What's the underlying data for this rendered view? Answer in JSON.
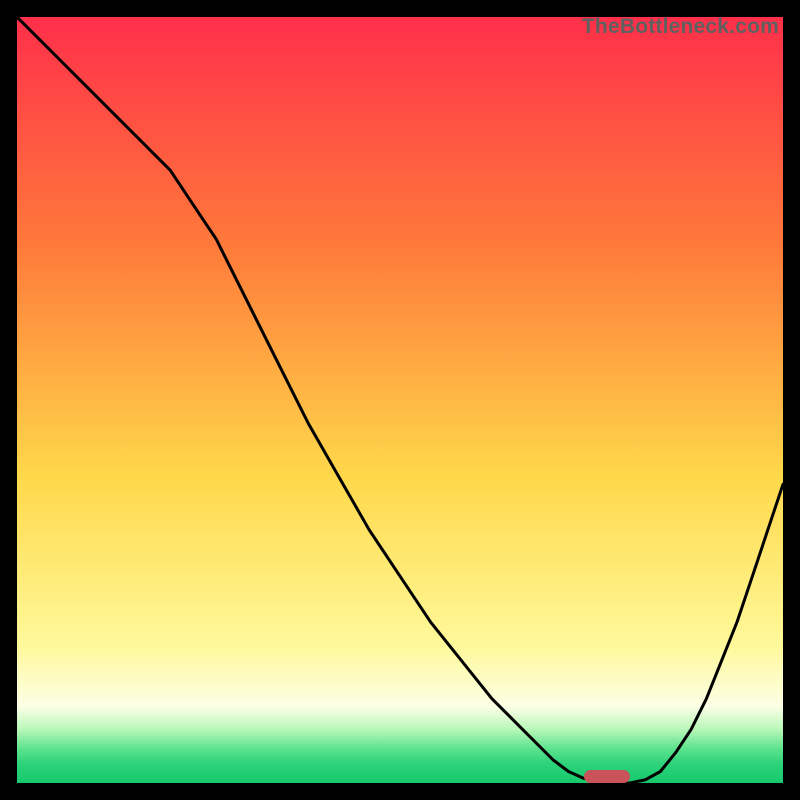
{
  "watermark_text": "TheBottleneck.com",
  "colors": {
    "background": "#000000",
    "gradient_top": "#ff2f4a",
    "gradient_mid_upper": "#ff7a3a",
    "gradient_mid": "#ffd84a",
    "gradient_mid_lower": "#fff99a",
    "gradient_pale": "#fcffe6",
    "gradient_green1": "#b8f7b8",
    "gradient_green2": "#5de38e",
    "gradient_green3": "#2dd37a",
    "gradient_bottom": "#15c96b",
    "curve": "#000000",
    "marker": "#c95359"
  },
  "chart_data": {
    "type": "line",
    "title": "",
    "xlabel": "",
    "ylabel": "",
    "xlim": [
      0,
      100
    ],
    "ylim": [
      0,
      100
    ],
    "x": [
      0,
      2,
      4,
      6,
      8,
      10,
      12,
      14,
      16,
      18,
      20,
      22,
      24,
      26,
      28,
      30,
      32,
      34,
      38,
      42,
      46,
      50,
      54,
      58,
      62,
      66,
      70,
      72,
      74,
      76,
      78,
      80,
      82,
      84,
      86,
      88,
      90,
      92,
      94,
      96,
      98,
      100
    ],
    "values": [
      100,
      98,
      96,
      94,
      92,
      90,
      88,
      86,
      84,
      82,
      80,
      77,
      74,
      71,
      67,
      63,
      59,
      55,
      47,
      40,
      33,
      27,
      21,
      16,
      11,
      7,
      3,
      1.5,
      0.6,
      0.2,
      0,
      0,
      0.4,
      1.5,
      4,
      7,
      11,
      16,
      21,
      27,
      33,
      39
    ],
    "marker": {
      "x_center": 77,
      "y": 0,
      "width_pct": 6
    }
  }
}
